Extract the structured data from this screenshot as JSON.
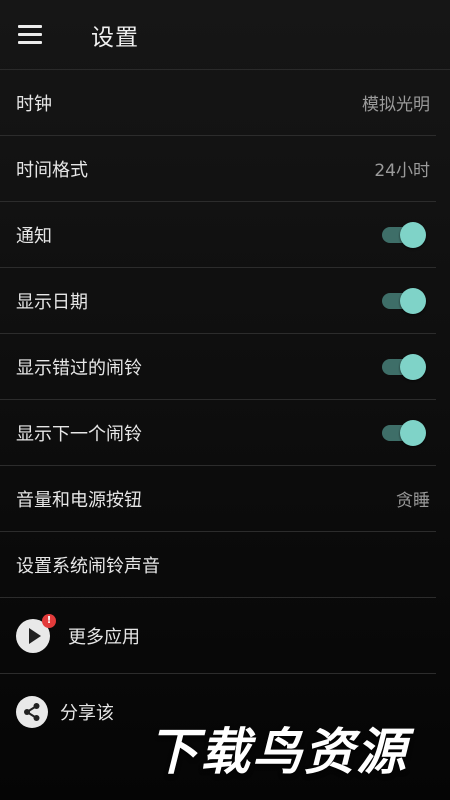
{
  "appbar": {
    "title": "设置",
    "menu_icon": "hamburger-menu-icon"
  },
  "settings": [
    {
      "label": "时钟",
      "value": "模拟光明"
    },
    {
      "label": "时间格式",
      "value": "24小时"
    },
    {
      "label": "通知",
      "toggle": true
    },
    {
      "label": "显示日期",
      "toggle": true
    },
    {
      "label": "显示错过的闹铃",
      "toggle": true
    },
    {
      "label": "显示下一个闹铃",
      "toggle": true
    },
    {
      "label": "音量和电源按钮",
      "value": "贪睡"
    },
    {
      "label": "设置系统闹铃声音"
    }
  ],
  "more_apps": {
    "label": "更多应用",
    "icon": "play-icon",
    "badge": "!"
  },
  "share": {
    "label": "分享该",
    "icon": "share-icon"
  },
  "watermark": {
    "text": "下载鸟资源"
  },
  "colors": {
    "toggle_thumb": "#7fd3c8",
    "toggle_track": "#3e6e68",
    "badge": "#e23b3b",
    "background": "#0c0c0c"
  }
}
